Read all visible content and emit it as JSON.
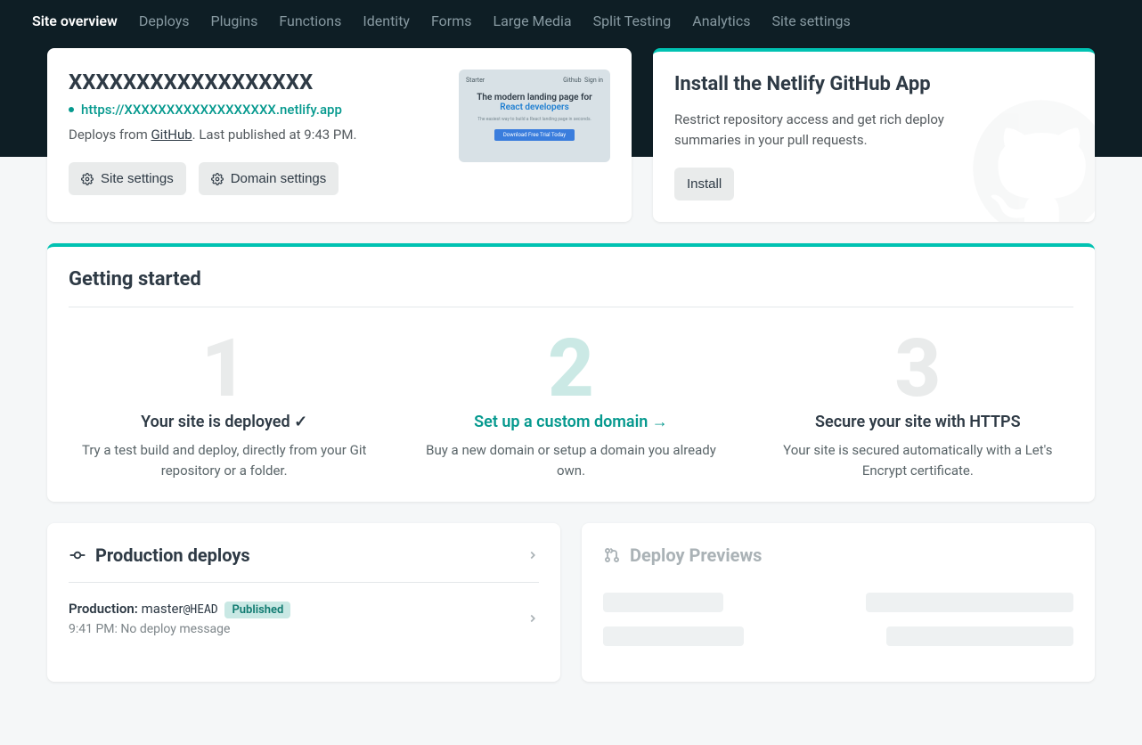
{
  "nav": {
    "items": [
      {
        "label": "Site overview",
        "active": true
      },
      {
        "label": "Deploys"
      },
      {
        "label": "Plugins"
      },
      {
        "label": "Functions"
      },
      {
        "label": "Identity"
      },
      {
        "label": "Forms"
      },
      {
        "label": "Large Media"
      },
      {
        "label": "Split Testing"
      },
      {
        "label": "Analytics"
      },
      {
        "label": "Site settings"
      }
    ]
  },
  "site": {
    "name": "XXXXXXXXXXXXXXXXXX",
    "url": "https://XXXXXXXXXXXXXXXXXX.netlify.app",
    "deploys_from_prefix": "Deploys from ",
    "deploys_source": "GitHub",
    "deploys_suffix": ". Last published at 9:43 PM.",
    "site_settings_label": "Site settings",
    "domain_settings_label": "Domain settings"
  },
  "preview": {
    "brand": "Starter",
    "nav1": "Github",
    "nav2": "Sign in",
    "line1": "The modern landing page for",
    "line2": "React developers",
    "sub": "The easiest way to build a React landing page in seconds.",
    "cta": "Download Free Trial Today"
  },
  "github_app": {
    "title": "Install the Netlify GitHub App",
    "desc": "Restrict repository access and get rich deploy summaries in your pull requests.",
    "install_label": "Install"
  },
  "getting_started": {
    "title": "Getting started",
    "steps": [
      {
        "num": "1",
        "title": "Your site is deployed",
        "check": "✓",
        "desc": "Try a test build and deploy, directly from your Git repository or a folder."
      },
      {
        "num": "2",
        "title": "Set up a custom domain →",
        "desc": "Buy a new domain or setup a domain you already own."
      },
      {
        "num": "3",
        "title": "Secure your site with HTTPS",
        "desc": "Your site is secured automatically with a Let's Encrypt certificate."
      }
    ]
  },
  "production": {
    "title": "Production deploys",
    "row": {
      "label": "Production:",
      "branch": "master",
      "at": "@",
      "head": "HEAD",
      "badge": "Published",
      "meta": "9:41 PM: No deploy message"
    }
  },
  "previews": {
    "title": "Deploy Previews"
  }
}
